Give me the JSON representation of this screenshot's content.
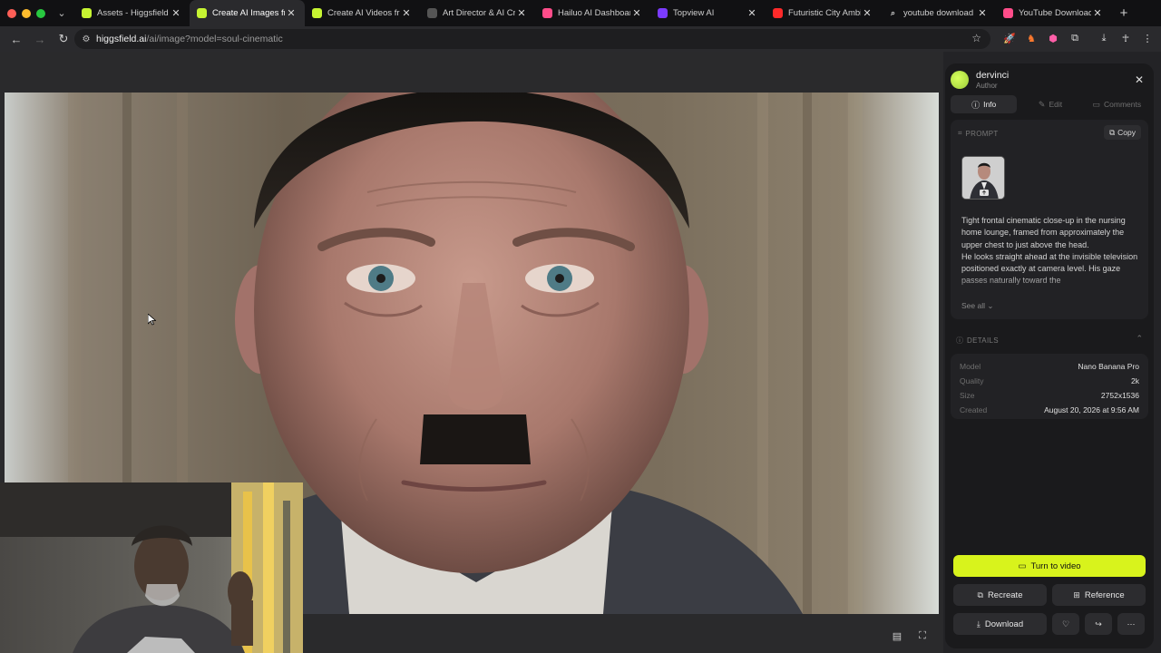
{
  "browser": {
    "tabs": [
      {
        "label": "Assets - Higgsfield",
        "favicon_color": "#c6f432",
        "active": false
      },
      {
        "label": "Create AI Images fro",
        "favicon_color": "#c6f432",
        "active": true
      },
      {
        "label": "Create AI Videos fro",
        "favicon_color": "#c6f432",
        "active": false
      },
      {
        "label": "Art Director & AI Cre",
        "favicon_color": "#555555",
        "active": false
      },
      {
        "label": "Hailuo AI Dashboard",
        "favicon_color": "#ff4d8a",
        "active": false
      },
      {
        "label": "Topview AI",
        "favicon_color": "#7b3bff",
        "active": false
      },
      {
        "label": "Futuristic City Ambie",
        "favicon_color": "#ff2a2a",
        "active": false
      },
      {
        "label": "youtube download or",
        "favicon_color": "#cccccc",
        "active": false
      },
      {
        "label": "YouTube Downloader",
        "favicon_color": "#ff4d8a",
        "active": false
      }
    ],
    "url_host": "higgsfield.ai",
    "url_path": "/ai/image?model=soul-cinematic"
  },
  "panel": {
    "author_name": "dervinci",
    "author_role": "Author",
    "tabs": {
      "info": "Info",
      "edit": "Edit",
      "comments": "Comments"
    },
    "prompt_label": "PROMPT",
    "copy_label": "Copy",
    "prompt_text": "Tight frontal cinematic close-up in the nursing home lounge, framed from approximately the upper chest to just above the head.\nHe looks straight ahead at the invisible television positioned exactly at camera level. His gaze passes naturally toward the",
    "see_all": "See all",
    "details_label": "DETAILS",
    "details": [
      {
        "key": "Model",
        "value": "Nano Banana Pro"
      },
      {
        "key": "Quality",
        "value": "2k"
      },
      {
        "key": "Size",
        "value": "2752x1536"
      },
      {
        "key": "Created",
        "value": "August 20, 2026 at 9:56 AM"
      }
    ],
    "primary_action": "Turn to video",
    "recreate": "Recreate",
    "reference": "Reference",
    "download": "Download",
    "accent_color": "#d8f31c"
  }
}
